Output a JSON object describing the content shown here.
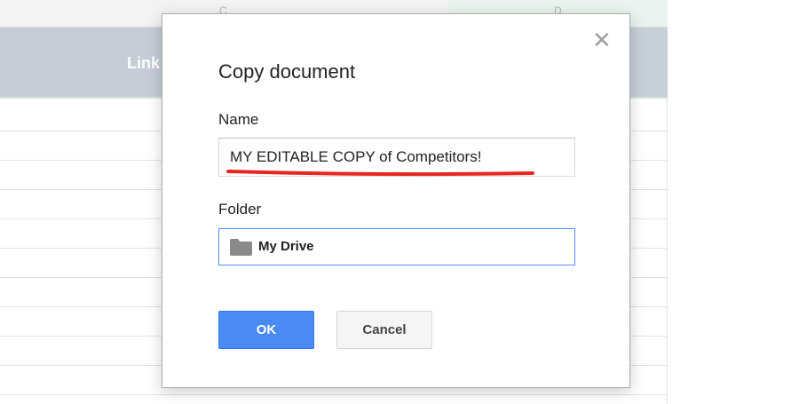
{
  "background_sheet": {
    "column_letters": [
      "C",
      "D"
    ],
    "header_text": "Link"
  },
  "dialog": {
    "title": "Copy document",
    "close_glyph": "✕",
    "name_label": "Name",
    "name_value": "MY EDITABLE COPY of Competitors!",
    "folder_label": "Folder",
    "folder_value": "My Drive",
    "ok_label": "OK",
    "cancel_label": "Cancel"
  },
  "icons": {
    "folder": "folder-icon",
    "close": "close-icon"
  },
  "colors": {
    "primary_button": "#4a8af4",
    "focus_border": "#4d90fe",
    "annotation_underline": "#e8261f"
  }
}
